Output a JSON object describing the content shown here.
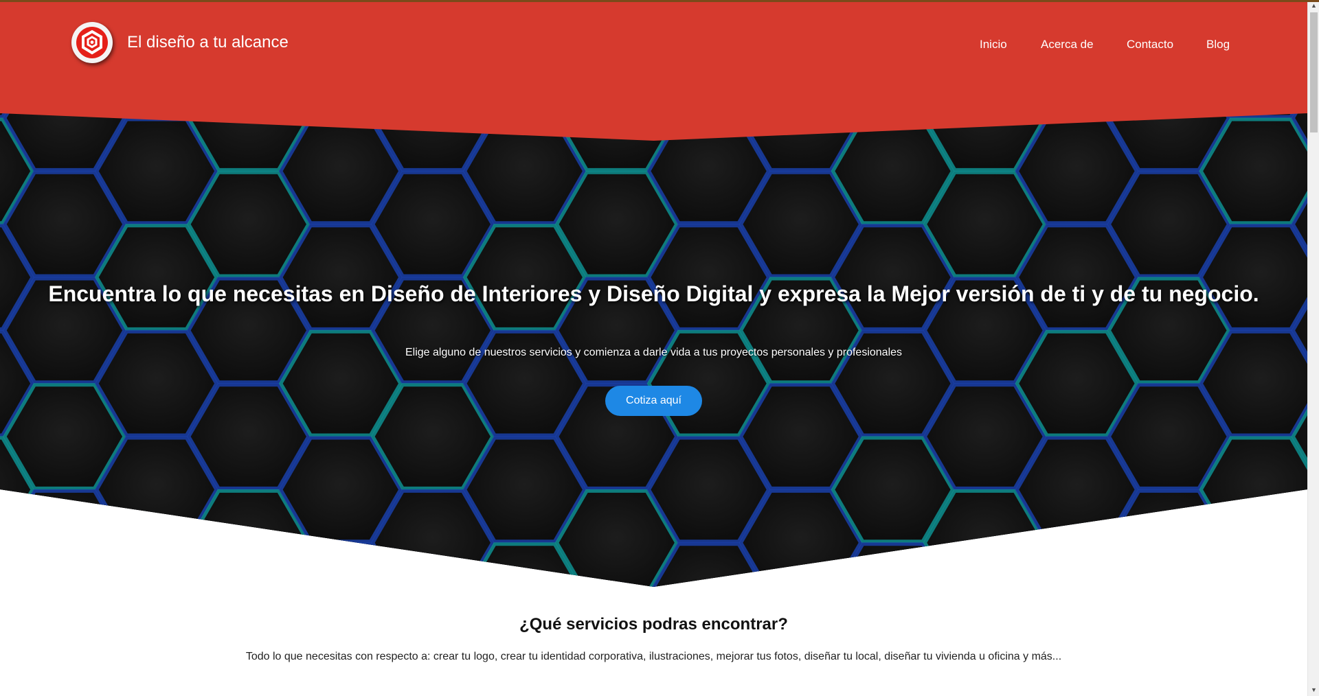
{
  "header": {
    "brand_name": "El diseño a tu alcance",
    "logo_icon": "hexagon-logo-icon",
    "nav": [
      {
        "label": "Inicio"
      },
      {
        "label": "Acerca de"
      },
      {
        "label": "Contacto"
      },
      {
        "label": "Blog"
      }
    ]
  },
  "hero": {
    "title": "Encuentra lo que necesitas en Diseño de Interiores y Diseño Digital y expresa la Mejor versión de ti y de tu negocio.",
    "subtitle": "Elige alguno de nuestros servicios y comienza a darle vida a tus proyectos personales y profesionales",
    "cta_label": "Cotiza aquí"
  },
  "services": {
    "title": "¿Qué servicios podras encontrar?",
    "description": "Todo lo que necesitas con respecto a: crear tu logo, crear tu identidad corporativa, ilustraciones, mejorar tus fotos, diseñar tu local, diseñar tu vivienda u oficina y más..."
  },
  "colors": {
    "header_red": "#d63a2e",
    "cta_blue": "#1e88e5",
    "hex_teal": "#0e8f8f",
    "hex_blue": "#1a3fa8"
  }
}
